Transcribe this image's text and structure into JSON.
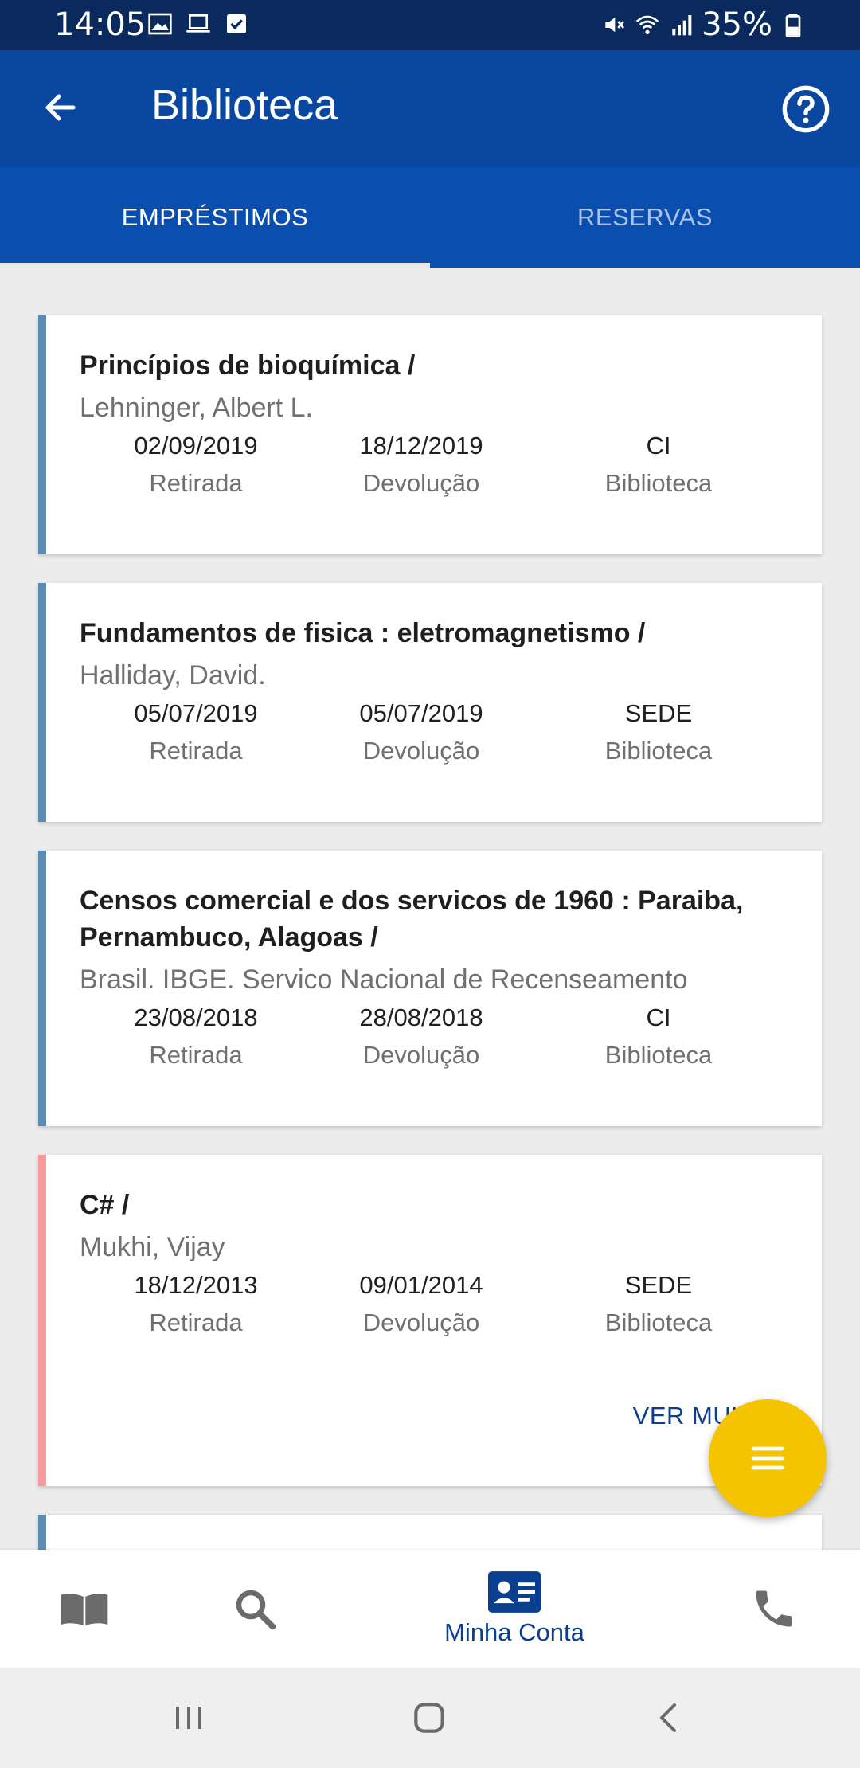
{
  "status_bar": {
    "time": "14:05",
    "battery": "35%",
    "icons_left": [
      "image-icon",
      "laptop-icon",
      "checkbox-icon"
    ],
    "icons_right": [
      "mute-icon",
      "wifi-icon",
      "signal-icon",
      "battery-icon"
    ]
  },
  "app_bar": {
    "title": "Biblioteca",
    "back_icon": "arrow-left-icon",
    "help_icon": "help-circle-icon"
  },
  "tabs": [
    {
      "label": "EMPRÉSTIMOS",
      "active": true
    },
    {
      "label": "RESERVAS",
      "active": false
    }
  ],
  "loans": [
    {
      "title": "Princípios de bioquímica /",
      "author": "Lehninger, Albert L.",
      "withdrawal_date": "02/09/2019",
      "withdrawal_label": "Retirada",
      "return_date": "18/12/2019",
      "return_label": "Devolução",
      "library": "CI",
      "library_label": "Biblioteca",
      "status": "normal"
    },
    {
      "title": "Fundamentos de fisica : eletromagnetismo /",
      "author": "Halliday, David.",
      "withdrawal_date": "05/07/2019",
      "withdrawal_label": "Retirada",
      "return_date": "05/07/2019",
      "return_label": "Devolução",
      "library": "SEDE",
      "library_label": "Biblioteca",
      "status": "normal"
    },
    {
      "title_line1": "Censos comercial e dos servicos de 1960 : Paraiba,",
      "title_line2": "Pernambuco, Alagoas /",
      "author": "Brasil. IBGE. Servico Nacional de Recenseamento",
      "withdrawal_date": "23/08/2018",
      "withdrawal_label": "Retirada",
      "return_date": "28/08/2018",
      "return_label": "Devolução",
      "library": "CI",
      "library_label": "Biblioteca",
      "status": "normal"
    },
    {
      "title": "C# /",
      "author": "Mukhi, Vijay",
      "withdrawal_date": "18/12/2013",
      "withdrawal_label": "Retirada",
      "return_date": "09/01/2014",
      "return_label": "Devolução",
      "library": "SEDE",
      "library_label": "Biblioteca",
      "status": "overdue",
      "action_label": "VER MULTA"
    }
  ],
  "fab": {
    "icon": "menu-icon",
    "color": "#f5c400"
  },
  "bottom_nav": [
    {
      "icon": "book-icon",
      "label": "",
      "active": false
    },
    {
      "icon": "search-icon",
      "label": "",
      "active": false
    },
    {
      "icon": "account-card-icon",
      "label": "Minha Conta",
      "active": true
    },
    {
      "icon": "phone-icon",
      "label": "",
      "active": false
    }
  ],
  "system_nav": [
    "recents-icon",
    "home-icon",
    "back-icon"
  ],
  "colors": {
    "primary_dark": "#0a2a5e",
    "primary": "#0a47a0",
    "tab_bar": "#0a4fb0",
    "card_accent": "#5a8db5",
    "overdue_accent": "#f49a9a",
    "fab": "#f5c400",
    "active_nav": "#0a3f8f"
  }
}
